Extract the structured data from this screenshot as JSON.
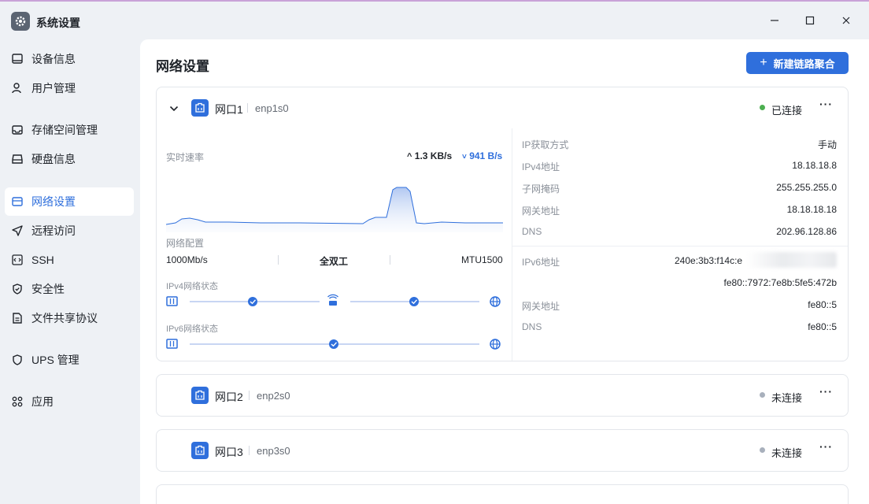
{
  "window": {
    "title": "系统设置"
  },
  "sidebar": {
    "items": [
      {
        "label": "设备信息",
        "icon": "monitor-icon"
      },
      {
        "label": "用户管理",
        "icon": "user-icon"
      },
      {
        "label": "存储空间管理",
        "icon": "storage-icon"
      },
      {
        "label": "硬盘信息",
        "icon": "disk-icon"
      },
      {
        "label": "网络设置",
        "icon": "network-icon",
        "active": true
      },
      {
        "label": "远程访问",
        "icon": "send-icon"
      },
      {
        "label": "SSH",
        "icon": "code-icon"
      },
      {
        "label": "安全性",
        "icon": "shield-check-icon"
      },
      {
        "label": "文件共享协议",
        "icon": "document-icon"
      },
      {
        "label": "UPS 管理",
        "icon": "shield-icon"
      },
      {
        "label": "应用",
        "icon": "apps-grid-icon"
      }
    ]
  },
  "main": {
    "title": "网络设置",
    "new_bond_button": "新建链路聚合",
    "ports": [
      {
        "name": "网口1",
        "device": "enp1s0",
        "status": "已连接",
        "status_color": "#4caf50",
        "expanded": true,
        "speed": {
          "label": "实时速率",
          "upload": "1.3 KB/s",
          "download": "941 B/s"
        },
        "config": {
          "label": "网络配置",
          "link_speed": "1000Mb/s",
          "duplex": "全双工",
          "mtu": "MTU1500"
        },
        "ipv4_status_label": "IPv4网络状态",
        "ipv6_status_label": "IPv6网络状态",
        "ipv4": [
          {
            "label": "IP获取方式",
            "value": "手动"
          },
          {
            "label": "IPv4地址",
            "value": "18.18.18.8"
          },
          {
            "label": "子网掩码",
            "value": "255.255.255.0"
          },
          {
            "label": "网关地址",
            "value": "18.18.18.18"
          },
          {
            "label": "DNS",
            "value": "202.96.128.86"
          }
        ],
        "ipv6": {
          "address_label": "IPv6地址",
          "address_1": "240e:3b3:f14c:e",
          "address_2": "fe80::7972:7e8b:5fe5:472b",
          "gateway_label": "网关地址",
          "gateway": "fe80::5",
          "dns_label": "DNS",
          "dns": "fe80::5"
        }
      },
      {
        "name": "网口2",
        "device": "enp2s0",
        "status": "未连接",
        "status_color": "#a8b0bc"
      },
      {
        "name": "网口3",
        "device": "enp3s0",
        "status": "未连接",
        "status_color": "#a8b0bc"
      }
    ]
  },
  "colors": {
    "accent": "#2f6fdc",
    "connected": "#4caf50",
    "disconnected": "#a8b0bc"
  }
}
